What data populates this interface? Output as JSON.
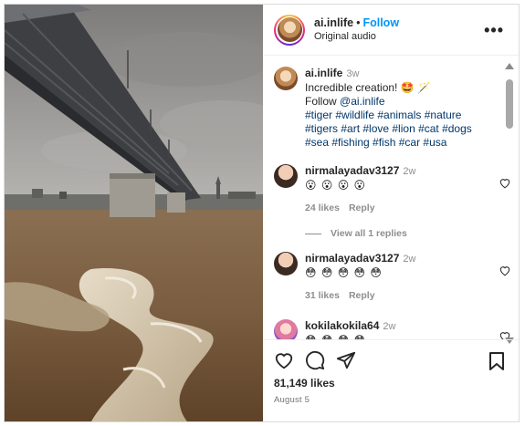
{
  "post": {
    "username": "ai.inlife",
    "follow_label": "Follow",
    "audio": "Original audio",
    "more_label": "•••"
  },
  "caption": {
    "username": "ai.inlife",
    "time": "3w",
    "line1": "Incredible creation! 🤩 🪄",
    "follow_text": "Follow",
    "mention": "@ai.inlife",
    "hashtags_line1": "#tiger #wildlife #animals #nature",
    "hashtags_line2": "#tigers #art #love #lion #cat #dogs",
    "hashtags_line3": "#sea #fishing #fish #car #usa"
  },
  "comments": [
    {
      "username": "nirmalayadav3127",
      "time": "2w",
      "text": "😮 😮 😮 😮",
      "likes": "24 likes",
      "reply_label": "Reply",
      "view_replies": "View all 1 replies"
    },
    {
      "username": "nirmalayadav3127",
      "time": "2w",
      "text": "😳 😳 😳 😳 😳",
      "likes": "31 likes",
      "reply_label": "Reply"
    },
    {
      "username": "kokilakokila64",
      "time": "2w",
      "text": "😳 😳 😳 😳"
    }
  ],
  "footer": {
    "likes": "81,149 likes",
    "date": "August 5"
  },
  "icons": {
    "like": "heart-icon",
    "comment": "comment-icon",
    "share": "share-icon",
    "save": "bookmark-icon",
    "more": "more-icon"
  },
  "colors": {
    "accent": "#0095f6",
    "link": "#00376b",
    "muted": "#8e8e8e"
  }
}
